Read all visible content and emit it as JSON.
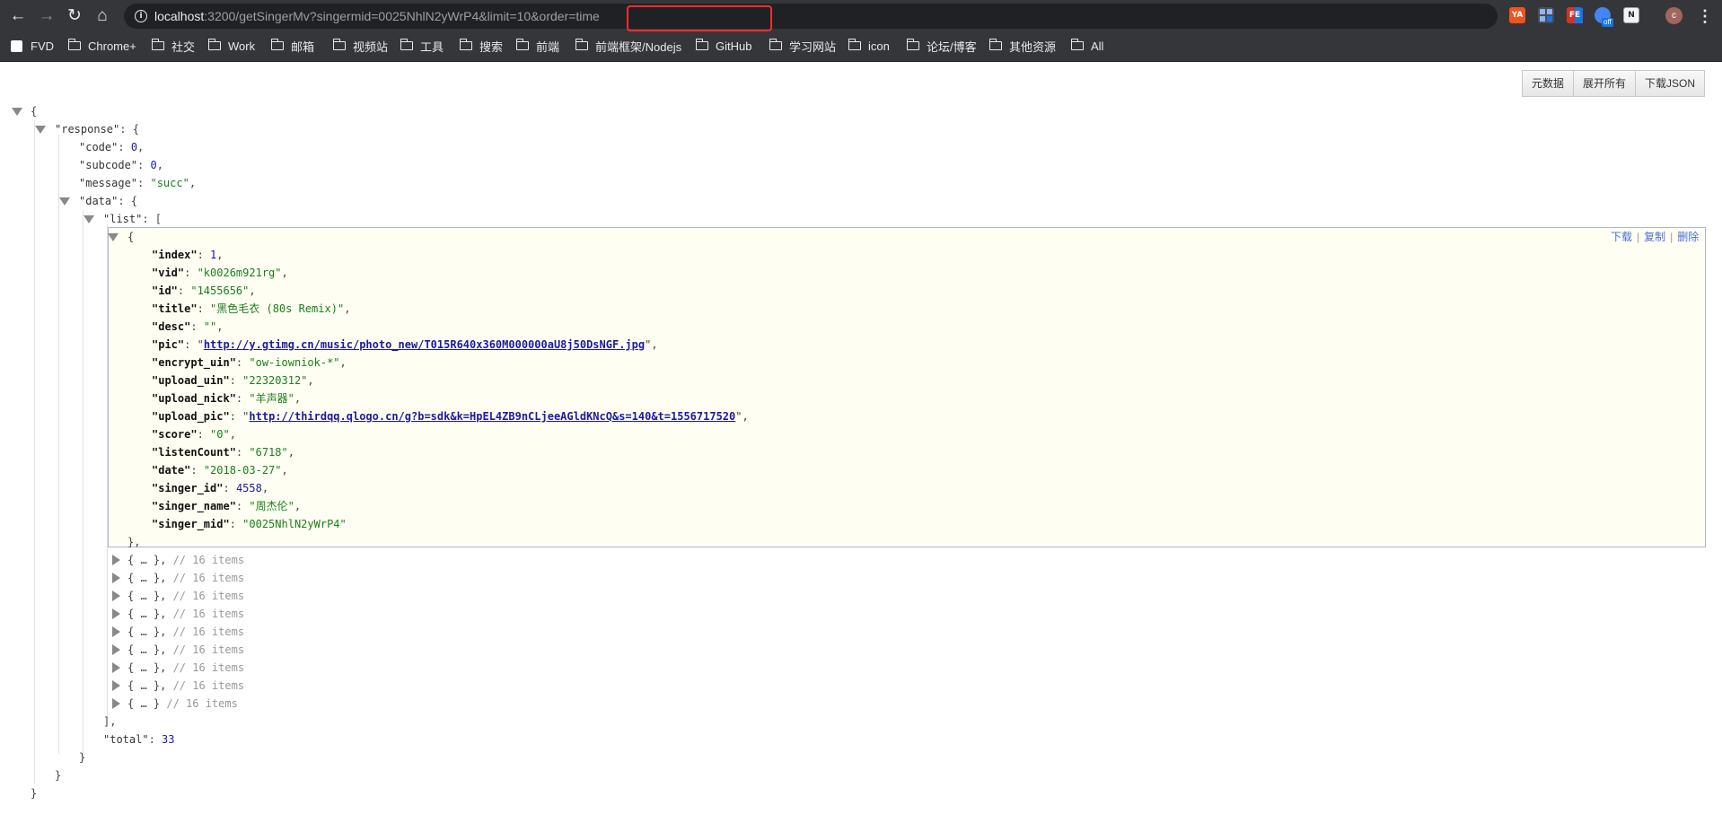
{
  "browser": {
    "url_host": "localhost",
    "url_rest": ":3200/getSingerMv?singermid=0025NhlN2yWrP4&limit=10&order=time",
    "extensions": [
      "ext-fa",
      "ext-grid",
      "ext-fe",
      "ext-proxy-off",
      "ext-notion"
    ],
    "ext_labels": {
      "fa": "YA",
      "fe": "FE",
      "off": "off",
      "notion": "N"
    },
    "avatar_letter": "c",
    "annotation_color": "#ff2d2d"
  },
  "bookmarks": [
    "FVD",
    "Chrome+",
    "社交",
    "Work",
    "邮箱",
    "视频站",
    "工具",
    "搜索",
    "前端",
    "前端框架/Nodejs",
    "GitHub",
    "学习网站",
    "icon",
    "论坛/博客",
    "其他资源",
    "All"
  ],
  "viewer": {
    "buttons": [
      "元数据",
      "展开所有",
      "下载JSON"
    ],
    "item_actions": [
      "下载",
      "复制",
      "删除"
    ],
    "collapsed_comment": "// 16 items",
    "collapsed_count": 9
  },
  "json": {
    "response_key": "\"response\"",
    "code_key": "\"code\"",
    "code": "0",
    "subcode_key": "\"subcode\"",
    "subcode": "0",
    "message_key": "\"message\"",
    "message": "\"succ\"",
    "data_key": "\"data\"",
    "list_key": "\"list\"",
    "total_key": "\"total\"",
    "total": "33",
    "item": [
      {
        "key": "\"index\"",
        "value": "1",
        "type": "num"
      },
      {
        "key": "\"vid\"",
        "value": "\"k0026m921rg\"",
        "type": "str"
      },
      {
        "key": "\"id\"",
        "value": "\"1455656\"",
        "type": "str"
      },
      {
        "key": "\"title\"",
        "value": "\"黑色毛衣 (80s Remix)\"",
        "type": "str"
      },
      {
        "key": "\"desc\"",
        "value": "\"\"",
        "type": "str"
      },
      {
        "key": "\"pic\"",
        "value": "http://y.gtimg.cn/music/photo_new/T015R640x360M000000aU8j50DsNGF.jpg",
        "type": "link"
      },
      {
        "key": "\"encrypt_uin\"",
        "value": "\"ow-iowniok-*\"",
        "type": "str"
      },
      {
        "key": "\"upload_uin\"",
        "value": "\"22320312\"",
        "type": "str"
      },
      {
        "key": "\"upload_nick\"",
        "value": "\"羊声器\"",
        "type": "str"
      },
      {
        "key": "\"upload_pic\"",
        "value": "http://thirdqq.qlogo.cn/g?b=sdk&k=HpEL4ZB9nCLjeeAGldKNcQ&s=140&t=1556717520",
        "type": "link"
      },
      {
        "key": "\"score\"",
        "value": "\"0\"",
        "type": "str"
      },
      {
        "key": "\"listenCount\"",
        "value": "\"6718\"",
        "type": "str"
      },
      {
        "key": "\"date\"",
        "value": "\"2018-03-27\"",
        "type": "str"
      },
      {
        "key": "\"singer_id\"",
        "value": "4558",
        "type": "num"
      },
      {
        "key": "\"singer_name\"",
        "value": "\"周杰伦\"",
        "type": "str"
      },
      {
        "key": "\"singer_mid\"",
        "value": "\"0025NhlN2yWrP4\"",
        "type": "str"
      }
    ]
  }
}
